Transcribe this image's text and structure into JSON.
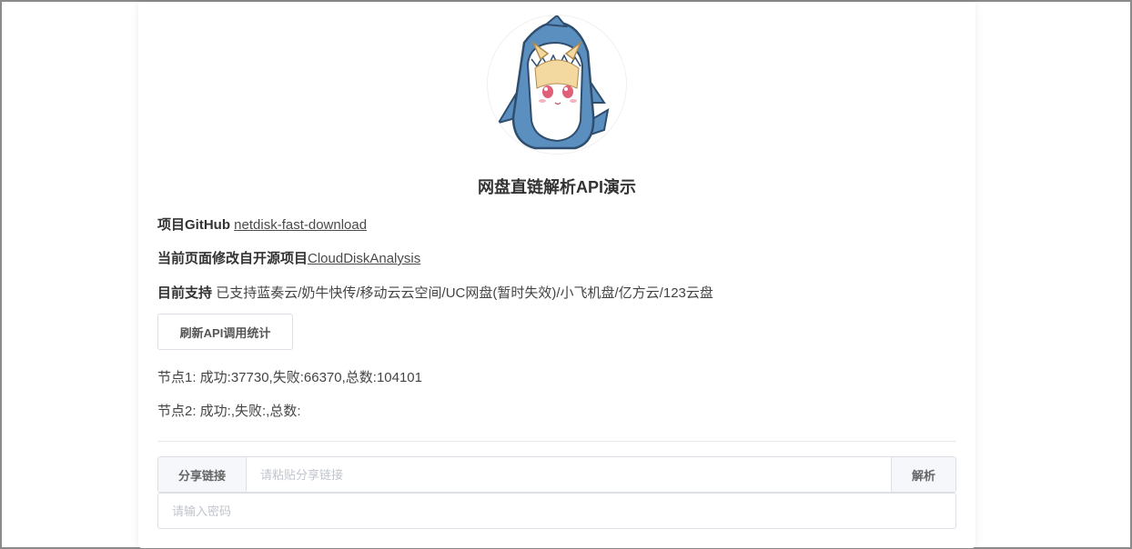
{
  "header": {
    "title": "网盘直链解析API演示"
  },
  "info": {
    "github_label": "项目GitHub",
    "github_link": "netdisk-fast-download",
    "source_label": "当前页面修改自开源项目",
    "source_link": "CloudDiskAnalysis",
    "support_label": "目前支持",
    "support_text": "已支持蓝奏云/奶牛快传/移动云云空间/UC网盘(暂时失效)/小飞机盘/亿方云/123云盘"
  },
  "stats": {
    "refresh_button": "刷新API调用统计",
    "node1": "节点1: 成功:37730,失败:66370,总数:104101",
    "node2": "节点2: 成功:,失败:,总数:"
  },
  "form": {
    "share_label": "分享链接",
    "share_placeholder": "请粘贴分享链接",
    "parse_button": "解析",
    "password_placeholder": "请输入密码"
  }
}
